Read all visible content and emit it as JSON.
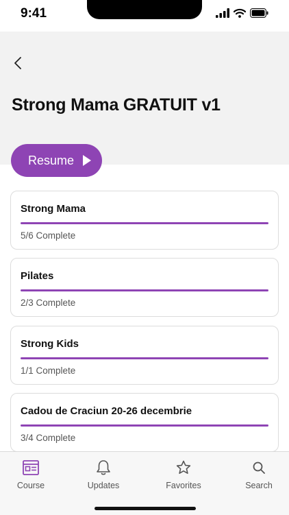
{
  "status_bar": {
    "time": "9:41"
  },
  "header": {
    "title": "Strong Mama GRATUIT v1"
  },
  "resume_button": {
    "label": "Resume"
  },
  "colors": {
    "accent": "#8e44b4",
    "header_bg": "#f2f2f2"
  },
  "modules": [
    {
      "title": "Strong Mama",
      "status": "5/6 Complete",
      "progress": 1.0
    },
    {
      "title": "Pilates",
      "status": "2/3 Complete",
      "progress": 1.0
    },
    {
      "title": "Strong Kids",
      "status": "1/1 Complete",
      "progress": 1.0
    },
    {
      "title": "Cadou de Craciun 20-26 decembrie",
      "status": "3/4 Complete",
      "progress": 1.0
    }
  ],
  "tabbar": {
    "tabs": [
      {
        "label": "Course",
        "icon": "course-icon"
      },
      {
        "label": "Updates",
        "icon": "bell-icon"
      },
      {
        "label": "Favorites",
        "icon": "star-icon"
      },
      {
        "label": "Search",
        "icon": "search-icon"
      }
    ]
  }
}
